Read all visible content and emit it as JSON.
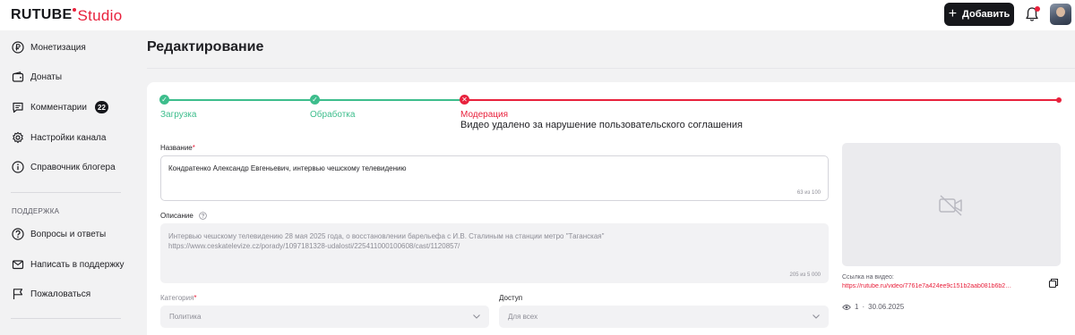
{
  "app": {
    "logo_main": "RUTUBE",
    "logo_sub": "Studio",
    "add_label": "Добавить"
  },
  "sidebar": {
    "items": [
      {
        "label": "Монетизация",
        "icon": "ruble-coin-icon"
      },
      {
        "label": "Донаты",
        "icon": "wallet-icon"
      },
      {
        "label": "Комментарии",
        "icon": "comment-icon",
        "badge": "22"
      },
      {
        "label": "Настройки канала",
        "icon": "gear-icon"
      },
      {
        "label": "Справочник блогера",
        "icon": "info-icon"
      }
    ],
    "section_title": "ПОДДЕРЖКА",
    "support_items": [
      {
        "label": "Вопросы и ответы",
        "icon": "question-icon"
      },
      {
        "label": "Написать в поддержку",
        "icon": "mail-icon"
      },
      {
        "label": "Пожаловаться",
        "icon": "flag-icon"
      }
    ]
  },
  "page": {
    "title": "Редактирование"
  },
  "stepper": {
    "steps": [
      {
        "label": "Загрузка",
        "status": "done"
      },
      {
        "label": "Обработка",
        "status": "done"
      },
      {
        "label": "Модерация",
        "status": "error"
      }
    ],
    "moderation_message": "Видео удалено за нарушение пользовательского соглашения",
    "colors": {
      "done": "#3dbd8c",
      "error": "#e8213c"
    }
  },
  "form": {
    "title": {
      "label": "Название",
      "required_mark": "*",
      "value": "Кондратенко Александр Евгеньевич, интервью чешскому телевидению",
      "counter": "63 из 100"
    },
    "description": {
      "label": "Описание",
      "line1": "Интервью чешскому телевидению 28 мая 2025 года, о восстановлении барельефа с И.В. Сталиным на станции метро \"Таганская\"",
      "line2": "https://www.ceskatelevize.cz/porady/1097181328-udalosti/225411000100608/cast/1120857/",
      "counter": "205 из 5 000"
    },
    "category": {
      "label": "Категория",
      "required_mark": "*",
      "value": "Политика"
    },
    "access": {
      "label": "Доступ",
      "value": "Для всех"
    }
  },
  "video": {
    "link_label": "Ссылка на видео:",
    "link_url": "https://rutube.ru/video/7761e7a424ee9c151b2aab081b6b2…",
    "views": "1",
    "separator": "·",
    "date": "30.06.2025"
  }
}
